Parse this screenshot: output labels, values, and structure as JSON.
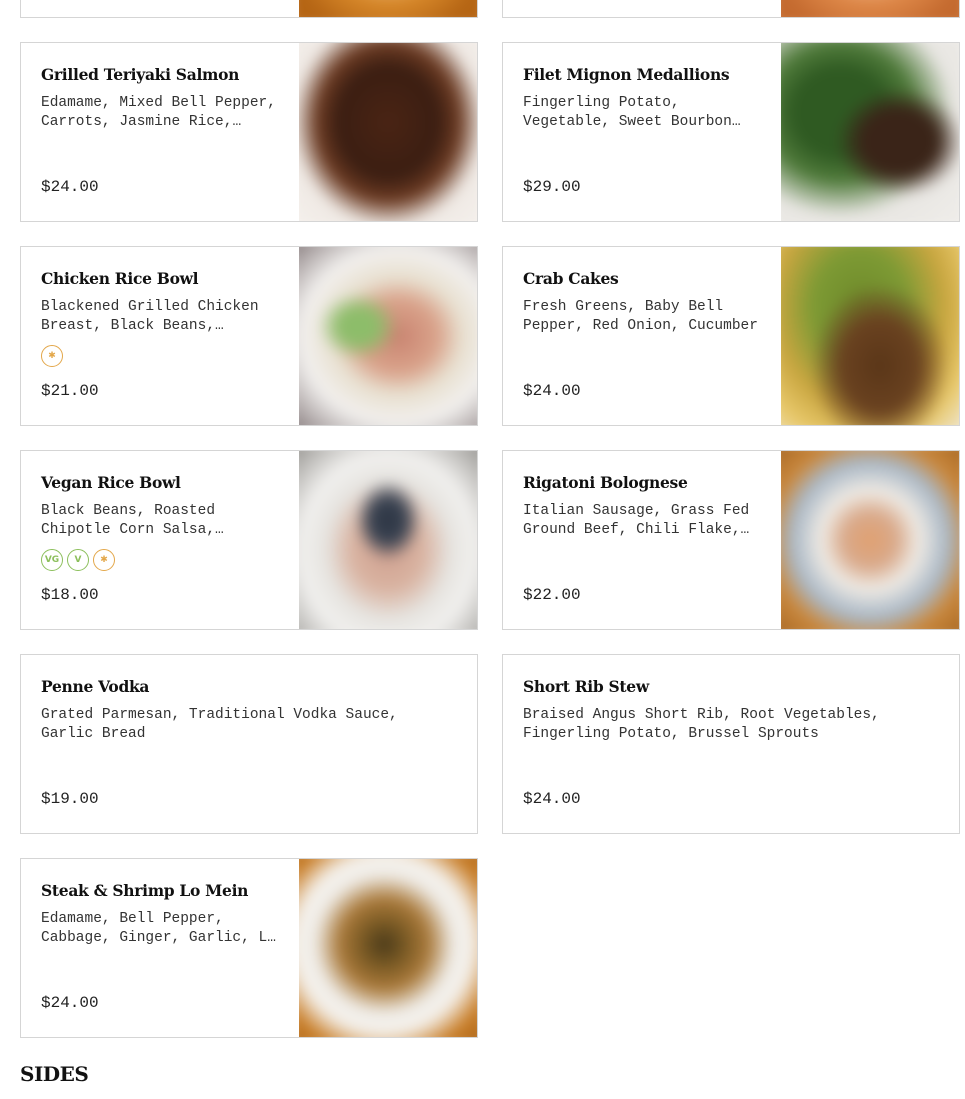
{
  "colors": {
    "card_border": "#d5d5d5",
    "gluten_free_badge": "#e3a74a",
    "vegan_badge": "#8cbf5c",
    "vegetarian_badge": "#8cbf5c"
  },
  "menu_items": [
    {
      "name": "Grilled Teriyaki Salmon",
      "description": "Edamame, Mixed Bell Pepper, Carrots, Jasmine Rice, Teriyaki Glaze",
      "price": "$24.00",
      "badges": [],
      "photo": "salmon"
    },
    {
      "name": "Filet Mignon Medallions",
      "description": "Fingerling Potato, Vegetable, Sweet Bourbon Glaze",
      "price": "$29.00",
      "badges": [],
      "photo": "filet"
    },
    {
      "name": "Chicken Rice Bowl",
      "description": "Blackened Grilled Chicken Breast, Black Beans, Roasted Corn Salsa",
      "price": "$21.00",
      "badges": [
        "gluten-free-icon"
      ],
      "photo": "chicken-bowl"
    },
    {
      "name": "Crab Cakes",
      "description": "Fresh Greens, Baby Bell Pepper, Red Onion, Cucumber",
      "price": "$24.00",
      "badges": [],
      "photo": "crab"
    },
    {
      "name": "Vegan Rice Bowl",
      "description": "Black Beans, Roasted Chipotle Corn Salsa, Avocado",
      "price": "$18.00",
      "badges": [
        "vegan-icon",
        "vegetarian-icon",
        "gluten-free-icon"
      ],
      "photo": "vegan-bowl"
    },
    {
      "name": "Rigatoni Bolognese",
      "description": "Italian Sausage, Grass Fed Ground Beef, Chili Flake, Parmesan",
      "price": "$22.00",
      "badges": [],
      "photo": "rigatoni"
    },
    {
      "name": "Penne Vodka",
      "description": "Grated Parmesan, Traditional Vodka Sauce, Garlic Bread",
      "price": "$19.00",
      "badges": [],
      "photo": null
    },
    {
      "name": "Short Rib Stew",
      "description": "Braised Angus Short Rib, Root Vegetables, Fingerling Potato, Brussel Sprouts",
      "price": "$24.00",
      "badges": [],
      "photo": null
    },
    {
      "name": "Steak & Shrimp Lo Mein",
      "description": "Edamame, Bell Pepper, Cabbage, Ginger, Garlic, Lo Mein Noodles",
      "price": "$24.00",
      "badges": [],
      "photo": "lo-mein"
    }
  ],
  "badge_labels": {
    "vegan": "VG",
    "vegetarian": "V",
    "gluten_free": "✱"
  },
  "sections": {
    "sides_title": "SIDES"
  }
}
